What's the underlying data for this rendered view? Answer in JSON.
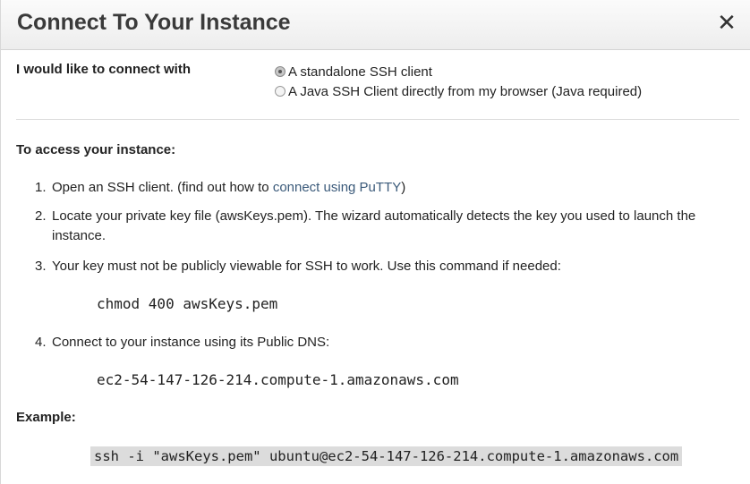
{
  "dialog": {
    "title": "Connect To Your Instance",
    "close_glyph": "✕"
  },
  "connect": {
    "label": "I would like to connect with",
    "options": [
      {
        "label": "A standalone SSH client",
        "selected": true
      },
      {
        "label": "A Java SSH Client directly from my browser (Java required)",
        "selected": false
      }
    ]
  },
  "instructions": {
    "heading": "To access your instance:",
    "steps": [
      {
        "num": "1.",
        "text_before": "Open an SSH client. (find out how to ",
        "link": "connect using PuTTY",
        "text_after": ")"
      },
      {
        "num": "2.",
        "text": "Locate your private key file (awsKeys.pem). The wizard automatically detects the key you used to launch the instance."
      },
      {
        "num": "3.",
        "text": "Your key must not be publicly viewable for SSH to work. Use this command if needed:"
      },
      {
        "num": "4.",
        "text": "Connect to your instance using its Public DNS:"
      }
    ],
    "chmod_command": "chmod 400 awsKeys.pem",
    "public_dns": "ec2-54-147-126-214.compute-1.amazonaws.com"
  },
  "example": {
    "label": "Example:",
    "command": "ssh -i \"awsKeys.pem\" ubuntu@ec2-54-147-126-214.compute-1.amazonaws.com"
  },
  "colors": {
    "link": "#3b5a7a",
    "code_highlight": "#dcdcdc"
  }
}
